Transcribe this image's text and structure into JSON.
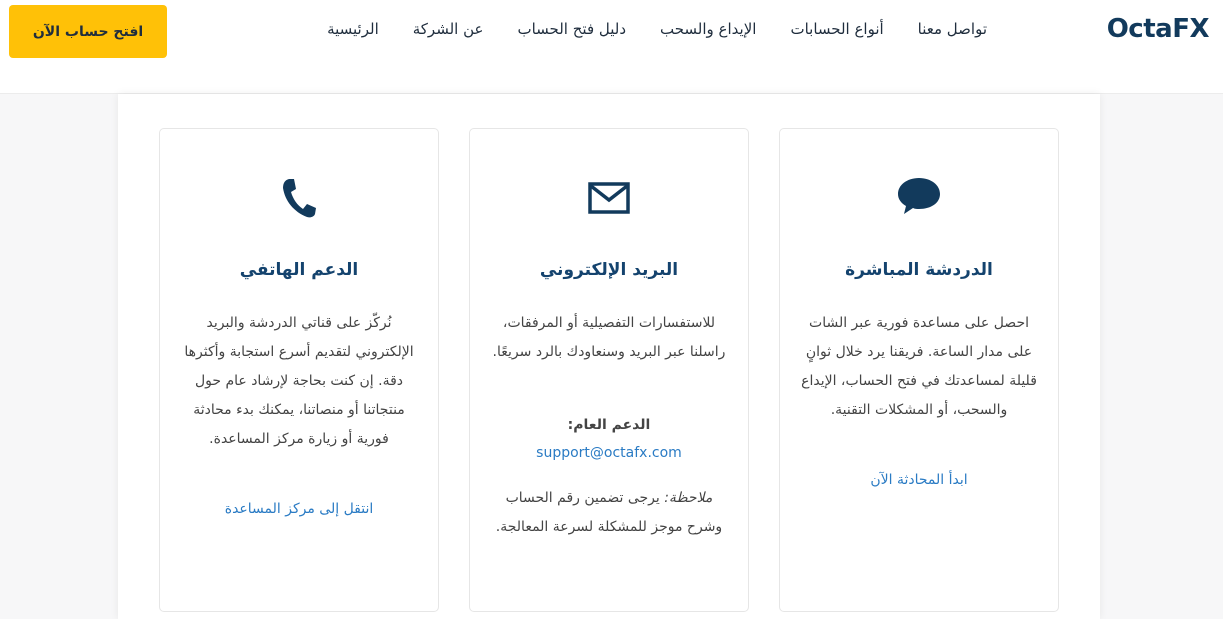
{
  "header": {
    "logo": "OctaFX",
    "nav": [
      "الرئيسية",
      "عن الشركة",
      "دليل فتح الحساب",
      "الإيداع والسحب",
      "أنواع الحسابات",
      "تواصل معنا"
    ],
    "cta": "افتح حساب الآن"
  },
  "cards": {
    "chat": {
      "icon": "chat-bubble-icon",
      "title": "الدردشة المباشرة",
      "body": "احصل على مساعدة فورية عبر الشات على مدار الساعة. فريقنا يرد خلال ثوانٍ قليلة لمساعدتك في فتح الحساب، الإيداع والسحب، أو المشكلات التقنية.",
      "link": "ابدأ المحادثة الآن"
    },
    "email": {
      "icon": "envelope-icon",
      "title": "البريد الإلكتروني",
      "body": "للاستفسارات التفصيلية أو المرفقات، راسلنا عبر البريد وسنعاودك بالرد سريعًا.",
      "support_label": "الدعم العام:",
      "support_email": "support@octafx.com",
      "note_label": "ملاحظة:",
      "note_text": " يرجى تضمين رقم الحساب وشرح موجز للمشكلة لسرعة المعالجة."
    },
    "phone": {
      "icon": "phone-icon",
      "title": "الدعم الهاتفي",
      "body": "نُركّز على قناتي الدردشة والبريد الإلكتروني لتقديم أسرع استجابة وأكثرها دقة. إن كنت بحاجة لإرشاد عام حول منتجاتنا أو منصاتنا، يمكنك بدء محادثة فورية أو زيارة مركز المساعدة.",
      "link": "انتقل إلى مركز المساعدة"
    }
  },
  "colors": {
    "brand": "#123a5c",
    "cta": "#ffc107",
    "link": "#2a7bc4",
    "title": "#14436e"
  }
}
